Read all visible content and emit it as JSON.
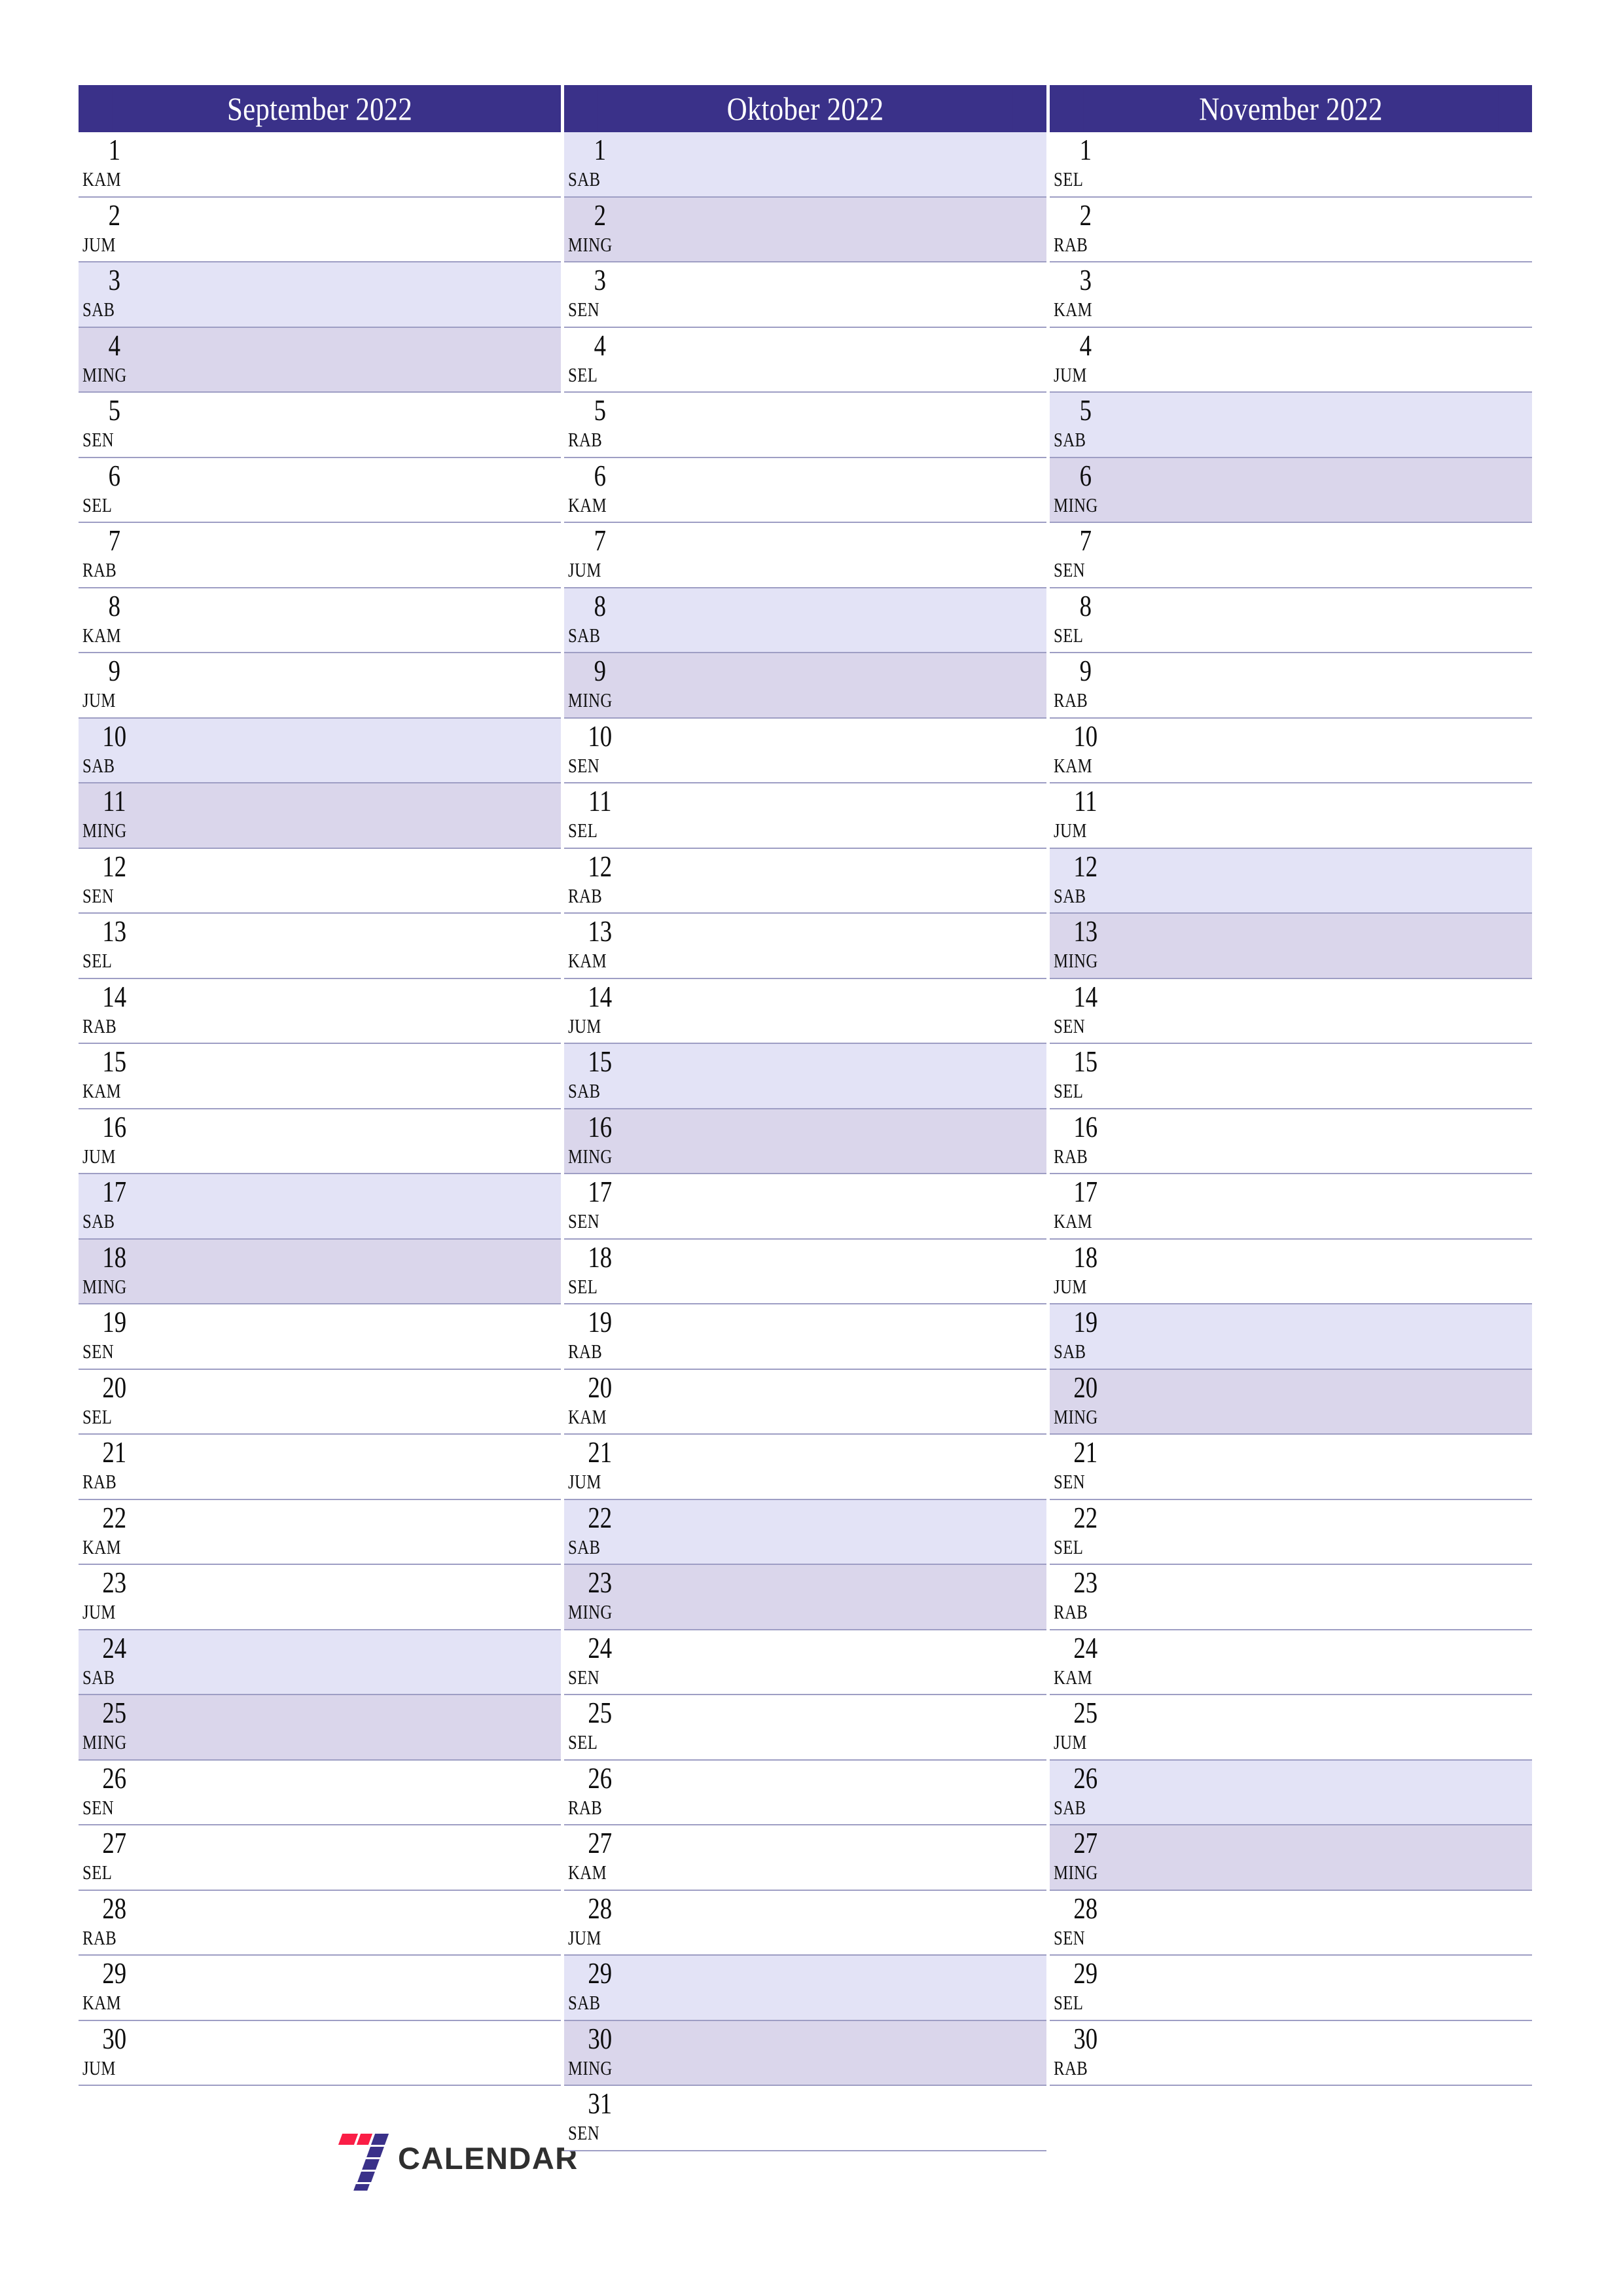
{
  "document": {
    "type": "calendar-planner",
    "year": "2022",
    "locale_day_names": [
      "SEN",
      "SEL",
      "RAB",
      "KAM",
      "JUM",
      "SAB",
      "MING"
    ]
  },
  "colors": {
    "header_bg": "#3a3189",
    "header_text": "#ffffff",
    "saturday_bg": "#e3e3f6",
    "sunday_bg": "#dad6eb",
    "row_border": "#9e9ec4",
    "page_bg": "#ffffff",
    "logo_red": "#fa1e46",
    "logo_purple": "#3a3189",
    "logo_text": "#2f2f2f"
  },
  "logo": {
    "mark": "seven-logo-icon",
    "text": "CALENDAR"
  },
  "months": [
    {
      "title": "September 2022",
      "days": [
        {
          "num": "1",
          "name": "KAM",
          "type": "weekday"
        },
        {
          "num": "2",
          "name": "JUM",
          "type": "weekday"
        },
        {
          "num": "3",
          "name": "SAB",
          "type": "saturday"
        },
        {
          "num": "4",
          "name": "MING",
          "type": "sunday"
        },
        {
          "num": "5",
          "name": "SEN",
          "type": "weekday"
        },
        {
          "num": "6",
          "name": "SEL",
          "type": "weekday"
        },
        {
          "num": "7",
          "name": "RAB",
          "type": "weekday"
        },
        {
          "num": "8",
          "name": "KAM",
          "type": "weekday"
        },
        {
          "num": "9",
          "name": "JUM",
          "type": "weekday"
        },
        {
          "num": "10",
          "name": "SAB",
          "type": "saturday"
        },
        {
          "num": "11",
          "name": "MING",
          "type": "sunday"
        },
        {
          "num": "12",
          "name": "SEN",
          "type": "weekday"
        },
        {
          "num": "13",
          "name": "SEL",
          "type": "weekday"
        },
        {
          "num": "14",
          "name": "RAB",
          "type": "weekday"
        },
        {
          "num": "15",
          "name": "KAM",
          "type": "weekday"
        },
        {
          "num": "16",
          "name": "JUM",
          "type": "weekday"
        },
        {
          "num": "17",
          "name": "SAB",
          "type": "saturday"
        },
        {
          "num": "18",
          "name": "MING",
          "type": "sunday"
        },
        {
          "num": "19",
          "name": "SEN",
          "type": "weekday"
        },
        {
          "num": "20",
          "name": "SEL",
          "type": "weekday"
        },
        {
          "num": "21",
          "name": "RAB",
          "type": "weekday"
        },
        {
          "num": "22",
          "name": "KAM",
          "type": "weekday"
        },
        {
          "num": "23",
          "name": "JUM",
          "type": "weekday"
        },
        {
          "num": "24",
          "name": "SAB",
          "type": "saturday"
        },
        {
          "num": "25",
          "name": "MING",
          "type": "sunday"
        },
        {
          "num": "26",
          "name": "SEN",
          "type": "weekday"
        },
        {
          "num": "27",
          "name": "SEL",
          "type": "weekday"
        },
        {
          "num": "28",
          "name": "RAB",
          "type": "weekday"
        },
        {
          "num": "29",
          "name": "KAM",
          "type": "weekday"
        },
        {
          "num": "30",
          "name": "JUM",
          "type": "weekday"
        }
      ]
    },
    {
      "title": "Oktober 2022",
      "days": [
        {
          "num": "1",
          "name": "SAB",
          "type": "saturday"
        },
        {
          "num": "2",
          "name": "MING",
          "type": "sunday"
        },
        {
          "num": "3",
          "name": "SEN",
          "type": "weekday"
        },
        {
          "num": "4",
          "name": "SEL",
          "type": "weekday"
        },
        {
          "num": "5",
          "name": "RAB",
          "type": "weekday"
        },
        {
          "num": "6",
          "name": "KAM",
          "type": "weekday"
        },
        {
          "num": "7",
          "name": "JUM",
          "type": "weekday"
        },
        {
          "num": "8",
          "name": "SAB",
          "type": "saturday"
        },
        {
          "num": "9",
          "name": "MING",
          "type": "sunday"
        },
        {
          "num": "10",
          "name": "SEN",
          "type": "weekday"
        },
        {
          "num": "11",
          "name": "SEL",
          "type": "weekday"
        },
        {
          "num": "12",
          "name": "RAB",
          "type": "weekday"
        },
        {
          "num": "13",
          "name": "KAM",
          "type": "weekday"
        },
        {
          "num": "14",
          "name": "JUM",
          "type": "weekday"
        },
        {
          "num": "15",
          "name": "SAB",
          "type": "saturday"
        },
        {
          "num": "16",
          "name": "MING",
          "type": "sunday"
        },
        {
          "num": "17",
          "name": "SEN",
          "type": "weekday"
        },
        {
          "num": "18",
          "name": "SEL",
          "type": "weekday"
        },
        {
          "num": "19",
          "name": "RAB",
          "type": "weekday"
        },
        {
          "num": "20",
          "name": "KAM",
          "type": "weekday"
        },
        {
          "num": "21",
          "name": "JUM",
          "type": "weekday"
        },
        {
          "num": "22",
          "name": "SAB",
          "type": "saturday"
        },
        {
          "num": "23",
          "name": "MING",
          "type": "sunday"
        },
        {
          "num": "24",
          "name": "SEN",
          "type": "weekday"
        },
        {
          "num": "25",
          "name": "SEL",
          "type": "weekday"
        },
        {
          "num": "26",
          "name": "RAB",
          "type": "weekday"
        },
        {
          "num": "27",
          "name": "KAM",
          "type": "weekday"
        },
        {
          "num": "28",
          "name": "JUM",
          "type": "weekday"
        },
        {
          "num": "29",
          "name": "SAB",
          "type": "saturday"
        },
        {
          "num": "30",
          "name": "MING",
          "type": "sunday"
        },
        {
          "num": "31",
          "name": "SEN",
          "type": "weekday"
        }
      ]
    },
    {
      "title": "November 2022",
      "days": [
        {
          "num": "1",
          "name": "SEL",
          "type": "weekday"
        },
        {
          "num": "2",
          "name": "RAB",
          "type": "weekday"
        },
        {
          "num": "3",
          "name": "KAM",
          "type": "weekday"
        },
        {
          "num": "4",
          "name": "JUM",
          "type": "weekday"
        },
        {
          "num": "5",
          "name": "SAB",
          "type": "saturday"
        },
        {
          "num": "6",
          "name": "MING",
          "type": "sunday"
        },
        {
          "num": "7",
          "name": "SEN",
          "type": "weekday"
        },
        {
          "num": "8",
          "name": "SEL",
          "type": "weekday"
        },
        {
          "num": "9",
          "name": "RAB",
          "type": "weekday"
        },
        {
          "num": "10",
          "name": "KAM",
          "type": "weekday"
        },
        {
          "num": "11",
          "name": "JUM",
          "type": "weekday"
        },
        {
          "num": "12",
          "name": "SAB",
          "type": "saturday"
        },
        {
          "num": "13",
          "name": "MING",
          "type": "sunday"
        },
        {
          "num": "14",
          "name": "SEN",
          "type": "weekday"
        },
        {
          "num": "15",
          "name": "SEL",
          "type": "weekday"
        },
        {
          "num": "16",
          "name": "RAB",
          "type": "weekday"
        },
        {
          "num": "17",
          "name": "KAM",
          "type": "weekday"
        },
        {
          "num": "18",
          "name": "JUM",
          "type": "weekday"
        },
        {
          "num": "19",
          "name": "SAB",
          "type": "saturday"
        },
        {
          "num": "20",
          "name": "MING",
          "type": "sunday"
        },
        {
          "num": "21",
          "name": "SEN",
          "type": "weekday"
        },
        {
          "num": "22",
          "name": "SEL",
          "type": "weekday"
        },
        {
          "num": "23",
          "name": "RAB",
          "type": "weekday"
        },
        {
          "num": "24",
          "name": "KAM",
          "type": "weekday"
        },
        {
          "num": "25",
          "name": "JUM",
          "type": "weekday"
        },
        {
          "num": "26",
          "name": "SAB",
          "type": "saturday"
        },
        {
          "num": "27",
          "name": "MING",
          "type": "sunday"
        },
        {
          "num": "28",
          "name": "SEN",
          "type": "weekday"
        },
        {
          "num": "29",
          "name": "SEL",
          "type": "weekday"
        },
        {
          "num": "30",
          "name": "RAB",
          "type": "weekday"
        }
      ]
    }
  ]
}
